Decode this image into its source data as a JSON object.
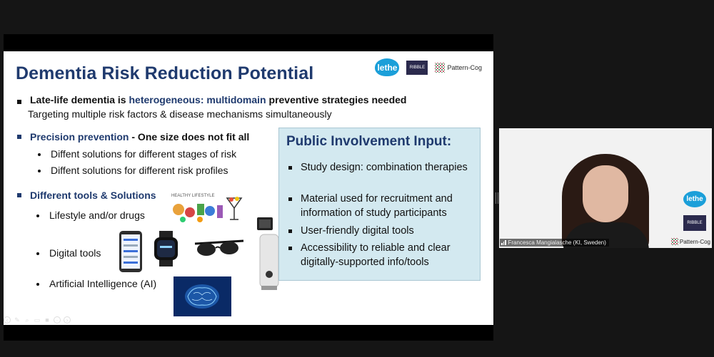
{
  "slide": {
    "title": "Dementia Risk Reduction Potential",
    "logos": {
      "lethe": "lethe",
      "ribble": "RIBBLE",
      "pattern_cog": "Pattern-Cog"
    },
    "point1": {
      "part1": "Late-life dementia is ",
      "part2": "heterogeneous:",
      "part3": " multidomain",
      "part4": " preventive strategies needed",
      "sub": "Targeting multiple risk factors & disease mechanisms simultaneously"
    },
    "point2": {
      "lead": "Precision prevention",
      "rest": " - One size does not fit all",
      "sub1": "Diffent solutions for different stages of risk",
      "sub2": "Diffent solutions for different risk profiles"
    },
    "point3": {
      "lead": "Different tools & Solutions",
      "sub1": "Lifestyle and/or drugs",
      "sub2": "Digital tools",
      "sub3": "Artificial Intelligence (AI)"
    },
    "lifestyle_image_text": "HEALTHY LIFESTYLE",
    "public_involvement": {
      "title": "Public Involvement Input:",
      "items": [
        "Study design: combination therapies",
        "Material used for recruitment and information of study participants",
        "User-friendly digital tools",
        "Accessibility to reliable and clear digitally-supported info/tools"
      ]
    }
  },
  "video": {
    "participant_name": "Francesca Mangialasche (KI, Sweden)",
    "logos": {
      "lethe": "lethe",
      "ribble": "RIBBLE",
      "pattern_cog": "Pattern-Cog"
    }
  },
  "colors": {
    "title_navy": "#1f3a6e",
    "box_bg": "#d3e9f0",
    "lethe_blue": "#1b9fd9"
  },
  "controls": [
    "back-icon",
    "pen-icon",
    "search-icon",
    "cc-icon",
    "camera-icon",
    "more-icon",
    "forward-icon"
  ]
}
